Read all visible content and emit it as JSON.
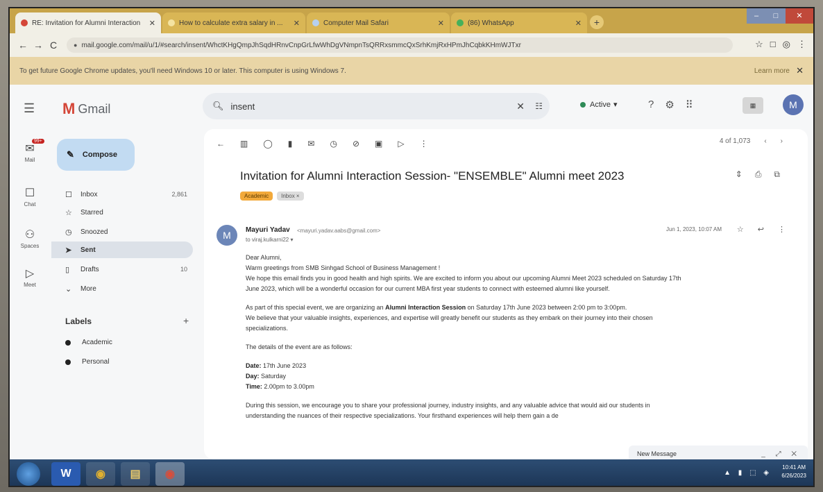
{
  "browser": {
    "tabs": [
      {
        "title": "RE: Invitation for Alumni Interaction",
        "active": true
      },
      {
        "title": "How to calculate extra salary in ...",
        "active": false
      },
      {
        "title": "Computer Mail Safari",
        "active": false
      },
      {
        "title": "(86) WhatsApp",
        "active": false
      }
    ],
    "new_tab": "+",
    "window_controls": {
      "min": "–",
      "max": "□",
      "close": "✕"
    },
    "nav": {
      "back": "←",
      "forward": "→",
      "reload": "C"
    },
    "url": "mail.google.com/mail/u/1/#search/insent/WhctKHgQmpJhSqdHRnvCnpGrLfwWhDgVNmpnTsQRRxsmmcQxSrhKmjRxHPmJhCqbkKHmWJTxr",
    "toolbar_right": [
      "☆",
      "□",
      "◎",
      "⋮"
    ]
  },
  "infobar": {
    "text": "To get future Google Chrome updates, you'll need Windows 10 or later. This computer is using Windows 7.",
    "link": "Learn more",
    "close": "✕"
  },
  "gmail": {
    "logo_m": "M",
    "logo_text": "Gmail",
    "search": {
      "query": "insent",
      "clear": "✕",
      "filter": "☷"
    },
    "status": "Active",
    "header_icons": [
      "?",
      "⚙",
      "⠿"
    ],
    "avatar_letter": "M",
    "rail": [
      {
        "label": "Mail",
        "icon": "✉",
        "badge": "99+"
      },
      {
        "label": "Chat",
        "icon": "☐"
      },
      {
        "label": "Spaces",
        "icon": "⚇"
      },
      {
        "label": "Meet",
        "icon": "▷"
      }
    ],
    "compose_label": "Compose",
    "nav": [
      {
        "icon": "☐",
        "label": "Inbox",
        "count": "2,861",
        "selected": false
      },
      {
        "icon": "☆",
        "label": "Starred",
        "count": "",
        "selected": false
      },
      {
        "icon": "◷",
        "label": "Snoozed",
        "count": "",
        "selected": false
      },
      {
        "icon": "➤",
        "label": "Sent",
        "count": "",
        "selected": true
      },
      {
        "icon": "▯",
        "label": "Drafts",
        "count": "10",
        "selected": false
      },
      {
        "icon": "⌄",
        "label": "More",
        "count": "",
        "selected": false
      }
    ],
    "labels_header": "Labels",
    "labels_add": "+",
    "labels": [
      "Academic",
      "Personal"
    ],
    "actions": [
      "←",
      "▥",
      "◯",
      "▮",
      "✉",
      "◷",
      "⊘",
      "▣",
      "▷",
      "⋮"
    ],
    "pager": [
      "4 of 1,073",
      "‹",
      "›"
    ],
    "subject": "Invitation for Alumni Interaction Session- \"ENSEMBLE\" Alumni meet 2023",
    "subject_icons": [
      "⇕",
      "⎙",
      "⧉"
    ],
    "tags": [
      "Academic",
      "Inbox ×"
    ],
    "message": {
      "avatar": "M",
      "sender": "Mayuri Yadav",
      "sender_email": "<mayuri.yadav.aabs@gmail.com>",
      "to": "to viraj.kulkarni22 ▾",
      "date": "Jun 1, 2023, 10:07 AM",
      "icons": [
        "☆",
        "↩",
        "⋮"
      ],
      "greeting": "Dear Alumni,",
      "lines": [
        "Warm greetings from SMB Sinhgad School of Business Management !",
        "We hope this email finds you in good health and high spirits. We are excited to inform you about our upcoming Alumni Meet 2023 scheduled on Saturday 17th",
        "June 2023, which will be a wonderful occasion for our current MBA first year students to connect with esteemed alumni like yourself."
      ],
      "para2_pre": "As part of this special event, we are organizing an ",
      "para2_bold": "Alumni Interaction Session",
      "para2_post": " on Saturday 17th June 2023 between 2:00 pm to 3:00pm.",
      "para2_line2": "We believe that your valuable insights, experiences, and expertise will greatly benefit our students as they embark on their journey into their chosen",
      "para2_line3": "specializations.",
      "details_intro": "The details of the event are as follows:",
      "date_label": "Date:",
      "date_value": " 17th June 2023",
      "day_label": "Day:",
      "day_value": " Saturday",
      "time_label": "Time:",
      "time_value": " 2.00pm to 3.00pm",
      "closing_line1": "During this session, we encourage you to share your professional journey, industry insights, and any valuable advice that would aid our students in",
      "closing_line2": "understanding the nuances of their respective specializations. Your firsthand experiences will help them gain a de"
    },
    "new_message": {
      "title": "New Message",
      "controls": "_ ⤢ ✕"
    }
  },
  "taskbar": {
    "apps": [
      "W",
      "◉",
      "▤",
      "◉"
    ],
    "tray": "▲ ▮ ⬚ ◈",
    "time": "10:41 AM",
    "date": "6/26/2023"
  },
  "colors": {
    "gmail_red": "#d44638",
    "compose_bg": "#c2dbf2",
    "chrome_tab": "#c7a44a",
    "tag_academic": "#f2a93b"
  }
}
